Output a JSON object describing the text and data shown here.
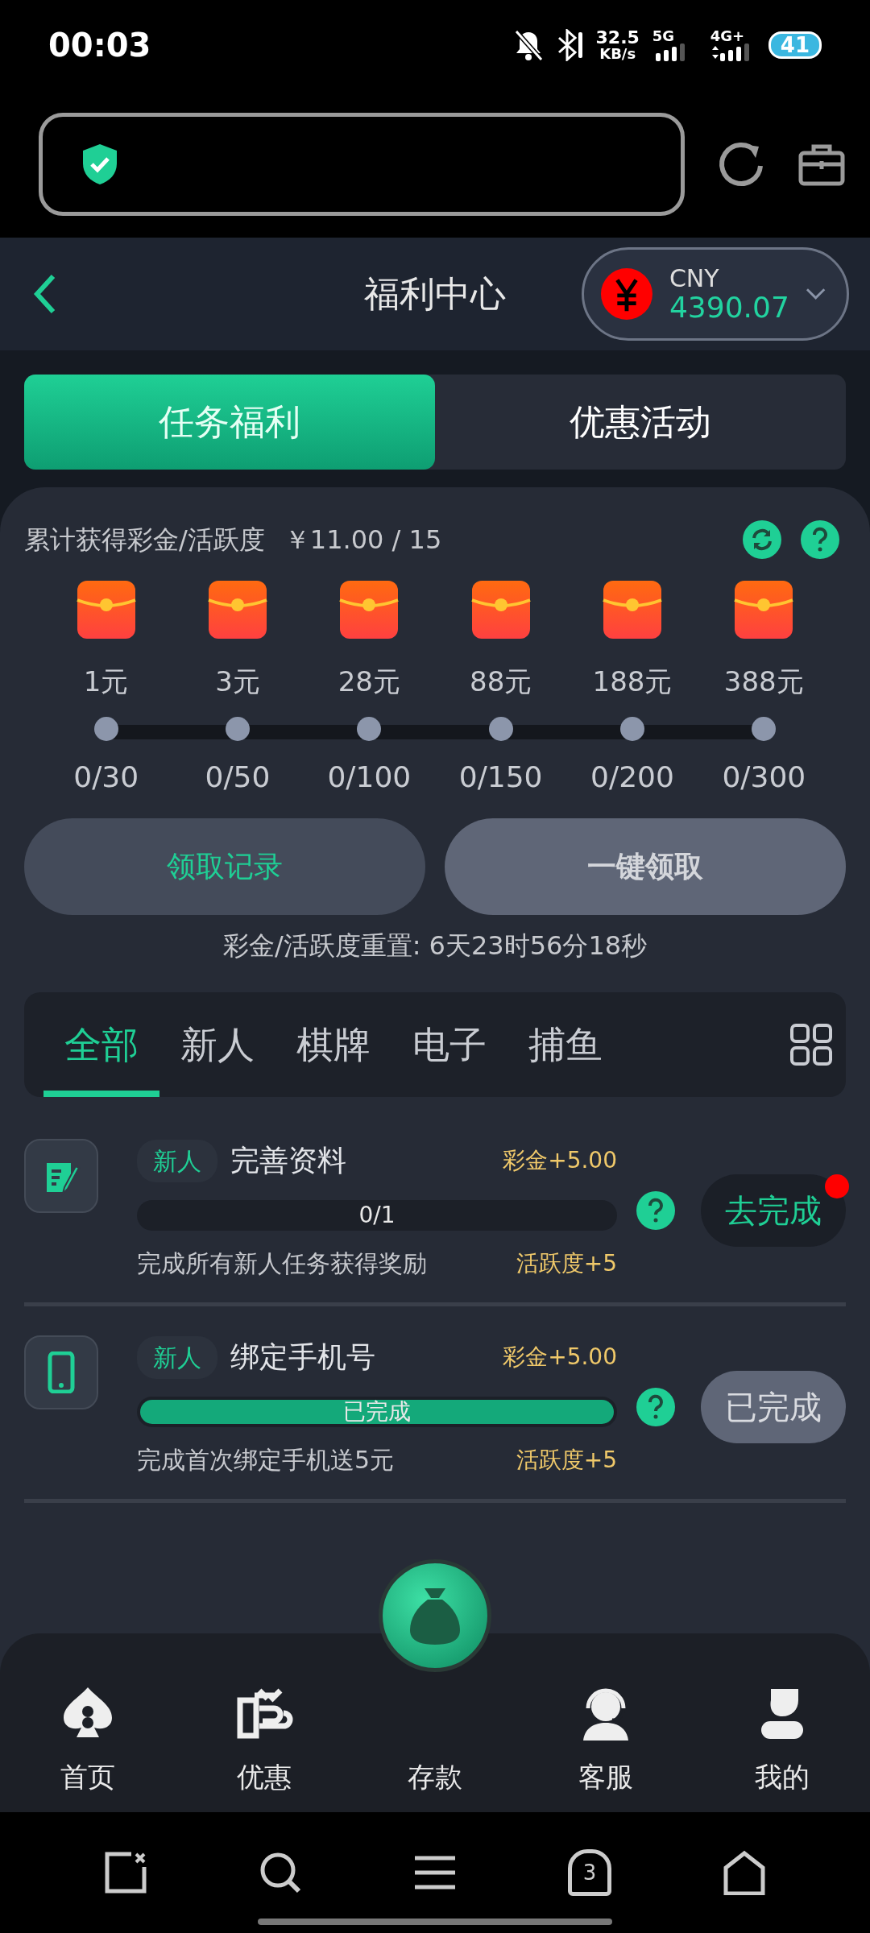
{
  "status_bar": {
    "time": "00:03",
    "speed": "32.5",
    "speed_unit": "KB/s",
    "network_1": "5G",
    "network_2": "4G+",
    "battery": "41"
  },
  "header": {
    "title": "福利中心",
    "currency": "CNY",
    "balance": "4390.07"
  },
  "tabs": [
    {
      "label": "任务福利",
      "selected": true
    },
    {
      "label": "优惠活动",
      "selected": false
    }
  ],
  "summary": {
    "label": "累计获得彩金/活跃度",
    "value": "￥11.00 / 15"
  },
  "milestones": [
    {
      "amount": "1元",
      "count": "0/30"
    },
    {
      "amount": "3元",
      "count": "0/50"
    },
    {
      "amount": "28元",
      "count": "0/100"
    },
    {
      "amount": "88元",
      "count": "0/150"
    },
    {
      "amount": "188元",
      "count": "0/200"
    },
    {
      "amount": "388元",
      "count": "0/300"
    }
  ],
  "actions": [
    {
      "label": "领取记录",
      "disabled": false
    },
    {
      "label": "一键领取",
      "disabled": true
    }
  ],
  "reset_text": "彩金/活跃度重置: 6天23时56分18秒",
  "categories": [
    {
      "label": "全部",
      "selected": true
    },
    {
      "label": "新人",
      "selected": false
    },
    {
      "label": "棋牌",
      "selected": false
    },
    {
      "label": "电子",
      "selected": false
    },
    {
      "label": "捕鱼",
      "selected": false
    }
  ],
  "tasks": [
    {
      "kind": "profile",
      "tag": "新人",
      "title": "完善资料",
      "reward": "彩金+5.00",
      "progress": "0/1",
      "level": 0,
      "description": "完成所有新人任务获得奖励",
      "activity": "活跃度+5",
      "button": "去完成",
      "completed": false,
      "badge": true
    },
    {
      "kind": "phone",
      "tag": "新人",
      "title": "绑定手机号",
      "reward": "彩金+5.00",
      "progress": "已完成",
      "level": 1,
      "description": "完成首次绑定手机送5元",
      "activity": "活跃度+5",
      "button": "已完成",
      "completed": true,
      "badge": false
    }
  ],
  "bottom_nav": [
    {
      "kind": "home",
      "label": "首页"
    },
    {
      "kind": "promo",
      "label": "优惠"
    },
    {
      "kind": "deposit",
      "label": "存款"
    },
    {
      "kind": "service",
      "label": "客服"
    },
    {
      "kind": "profile",
      "label": "我的"
    }
  ],
  "system_nav": {
    "tabs_count": "3"
  }
}
